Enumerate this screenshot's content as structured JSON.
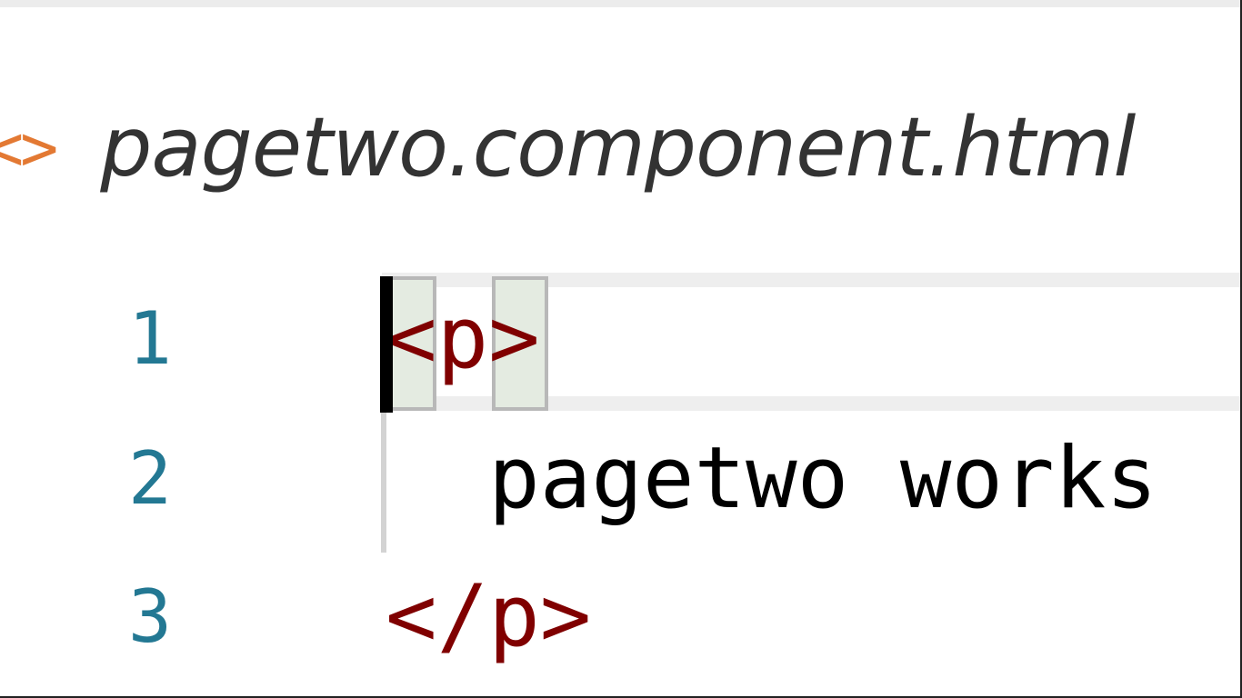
{
  "breadcrumb": {
    "icon": "html-file-icon",
    "icon_glyph": "<>",
    "file_name": "pagetwo.component.html"
  },
  "editor": {
    "lines": [
      {
        "number": "1",
        "parts": {
          "open_bracket": "<",
          "tag": "p",
          "close_bracket": ">"
        }
      },
      {
        "number": "2",
        "text": "  pagetwo works"
      },
      {
        "number": "3",
        "parts": {
          "open_bracket": "</",
          "tag": "p",
          "close_bracket": ">"
        }
      }
    ]
  },
  "colors": {
    "line_number": "#237893",
    "tag": "#800000",
    "file_icon": "#e37933",
    "bracket_match_bg": "#e4ebe1"
  }
}
